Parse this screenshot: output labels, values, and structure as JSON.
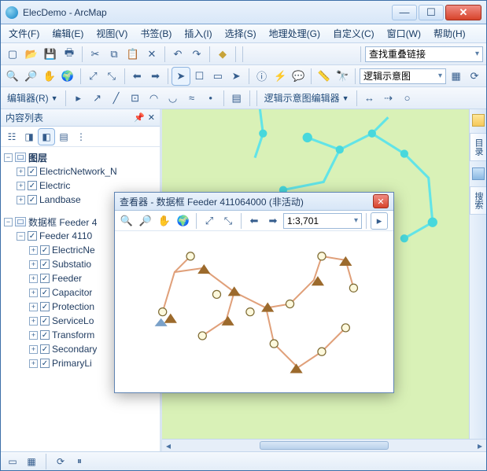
{
  "window": {
    "title": "ElecDemo - ArcMap"
  },
  "menu": {
    "items": [
      "文件(F)",
      "编辑(E)",
      "视图(V)",
      "书签(B)",
      "插入(I)",
      "选择(S)",
      "地理处理(G)",
      "自定义(C)",
      "窗口(W)",
      "帮助(H)"
    ]
  },
  "toolbar1": {
    "search_combo": "查找重叠链接"
  },
  "toolbar2": {
    "schematic_combo": "逻辑示意图"
  },
  "toolbar3": {
    "editor_label": "编辑器(R)",
    "editor_dropdown": "▼",
    "schematic_editor_label": "逻辑示意图编辑器"
  },
  "toc": {
    "title": "内容列表",
    "groups": [
      {
        "name": "图层",
        "items": [
          "ElectricNetwork_N",
          "Electric",
          "Landbase"
        ]
      },
      {
        "name": "数据框 Feeder 4",
        "feeder": "Feeder 4110",
        "items": [
          "ElectricNe",
          "Substatio",
          "Feeder",
          "Capacitor",
          "Protection",
          "ServiceLo",
          "Transform",
          "Secondary",
          "PrimaryLi"
        ]
      }
    ]
  },
  "viewer": {
    "title": "查看器 - 数据框 Feeder 411064000 (非活动)",
    "scale": "1:3,701"
  },
  "side": {
    "tab1": "目录",
    "tab2": "搜索"
  },
  "winbtns": {
    "min": "—",
    "max": "☐",
    "close": "✕"
  }
}
